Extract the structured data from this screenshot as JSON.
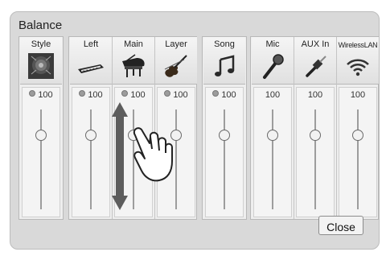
{
  "window": {
    "title": "Balance"
  },
  "groups": [
    {
      "channels": [
        {
          "name": "Style",
          "icon": "style-speaker-icon",
          "volume": "100",
          "fader_level": 1.0
        }
      ]
    },
    {
      "channels": [
        {
          "name": "Left",
          "icon": "keyboard-icon",
          "volume": "100",
          "fader_level": 1.0
        },
        {
          "name": "Main",
          "icon": "grand-piano-icon",
          "volume": "100",
          "fader_level": 1.0
        },
        {
          "name": "Layer",
          "icon": "violin-icon",
          "volume": "100",
          "fader_level": 1.0
        }
      ]
    },
    {
      "channels": [
        {
          "name": "Song",
          "icon": "music-note-icon",
          "volume": "100",
          "fader_level": 1.0
        }
      ]
    },
    {
      "channels": [
        {
          "name": "Mic",
          "icon": "microphone-icon",
          "volume": "100",
          "fader_level": 1.0
        },
        {
          "name": "AUX In",
          "icon": "aux-plug-icon",
          "volume": "100",
          "fader_level": 1.0
        },
        {
          "name": "WirelessLAN",
          "icon": "wifi-icon",
          "volume": "100",
          "fader_level": 1.0
        }
      ]
    }
  ],
  "buttons": {
    "close_label": "Close"
  },
  "overlay": {
    "gesture_icon": "hand-drag-icon",
    "arrow": "vertical-drag-arrow"
  }
}
